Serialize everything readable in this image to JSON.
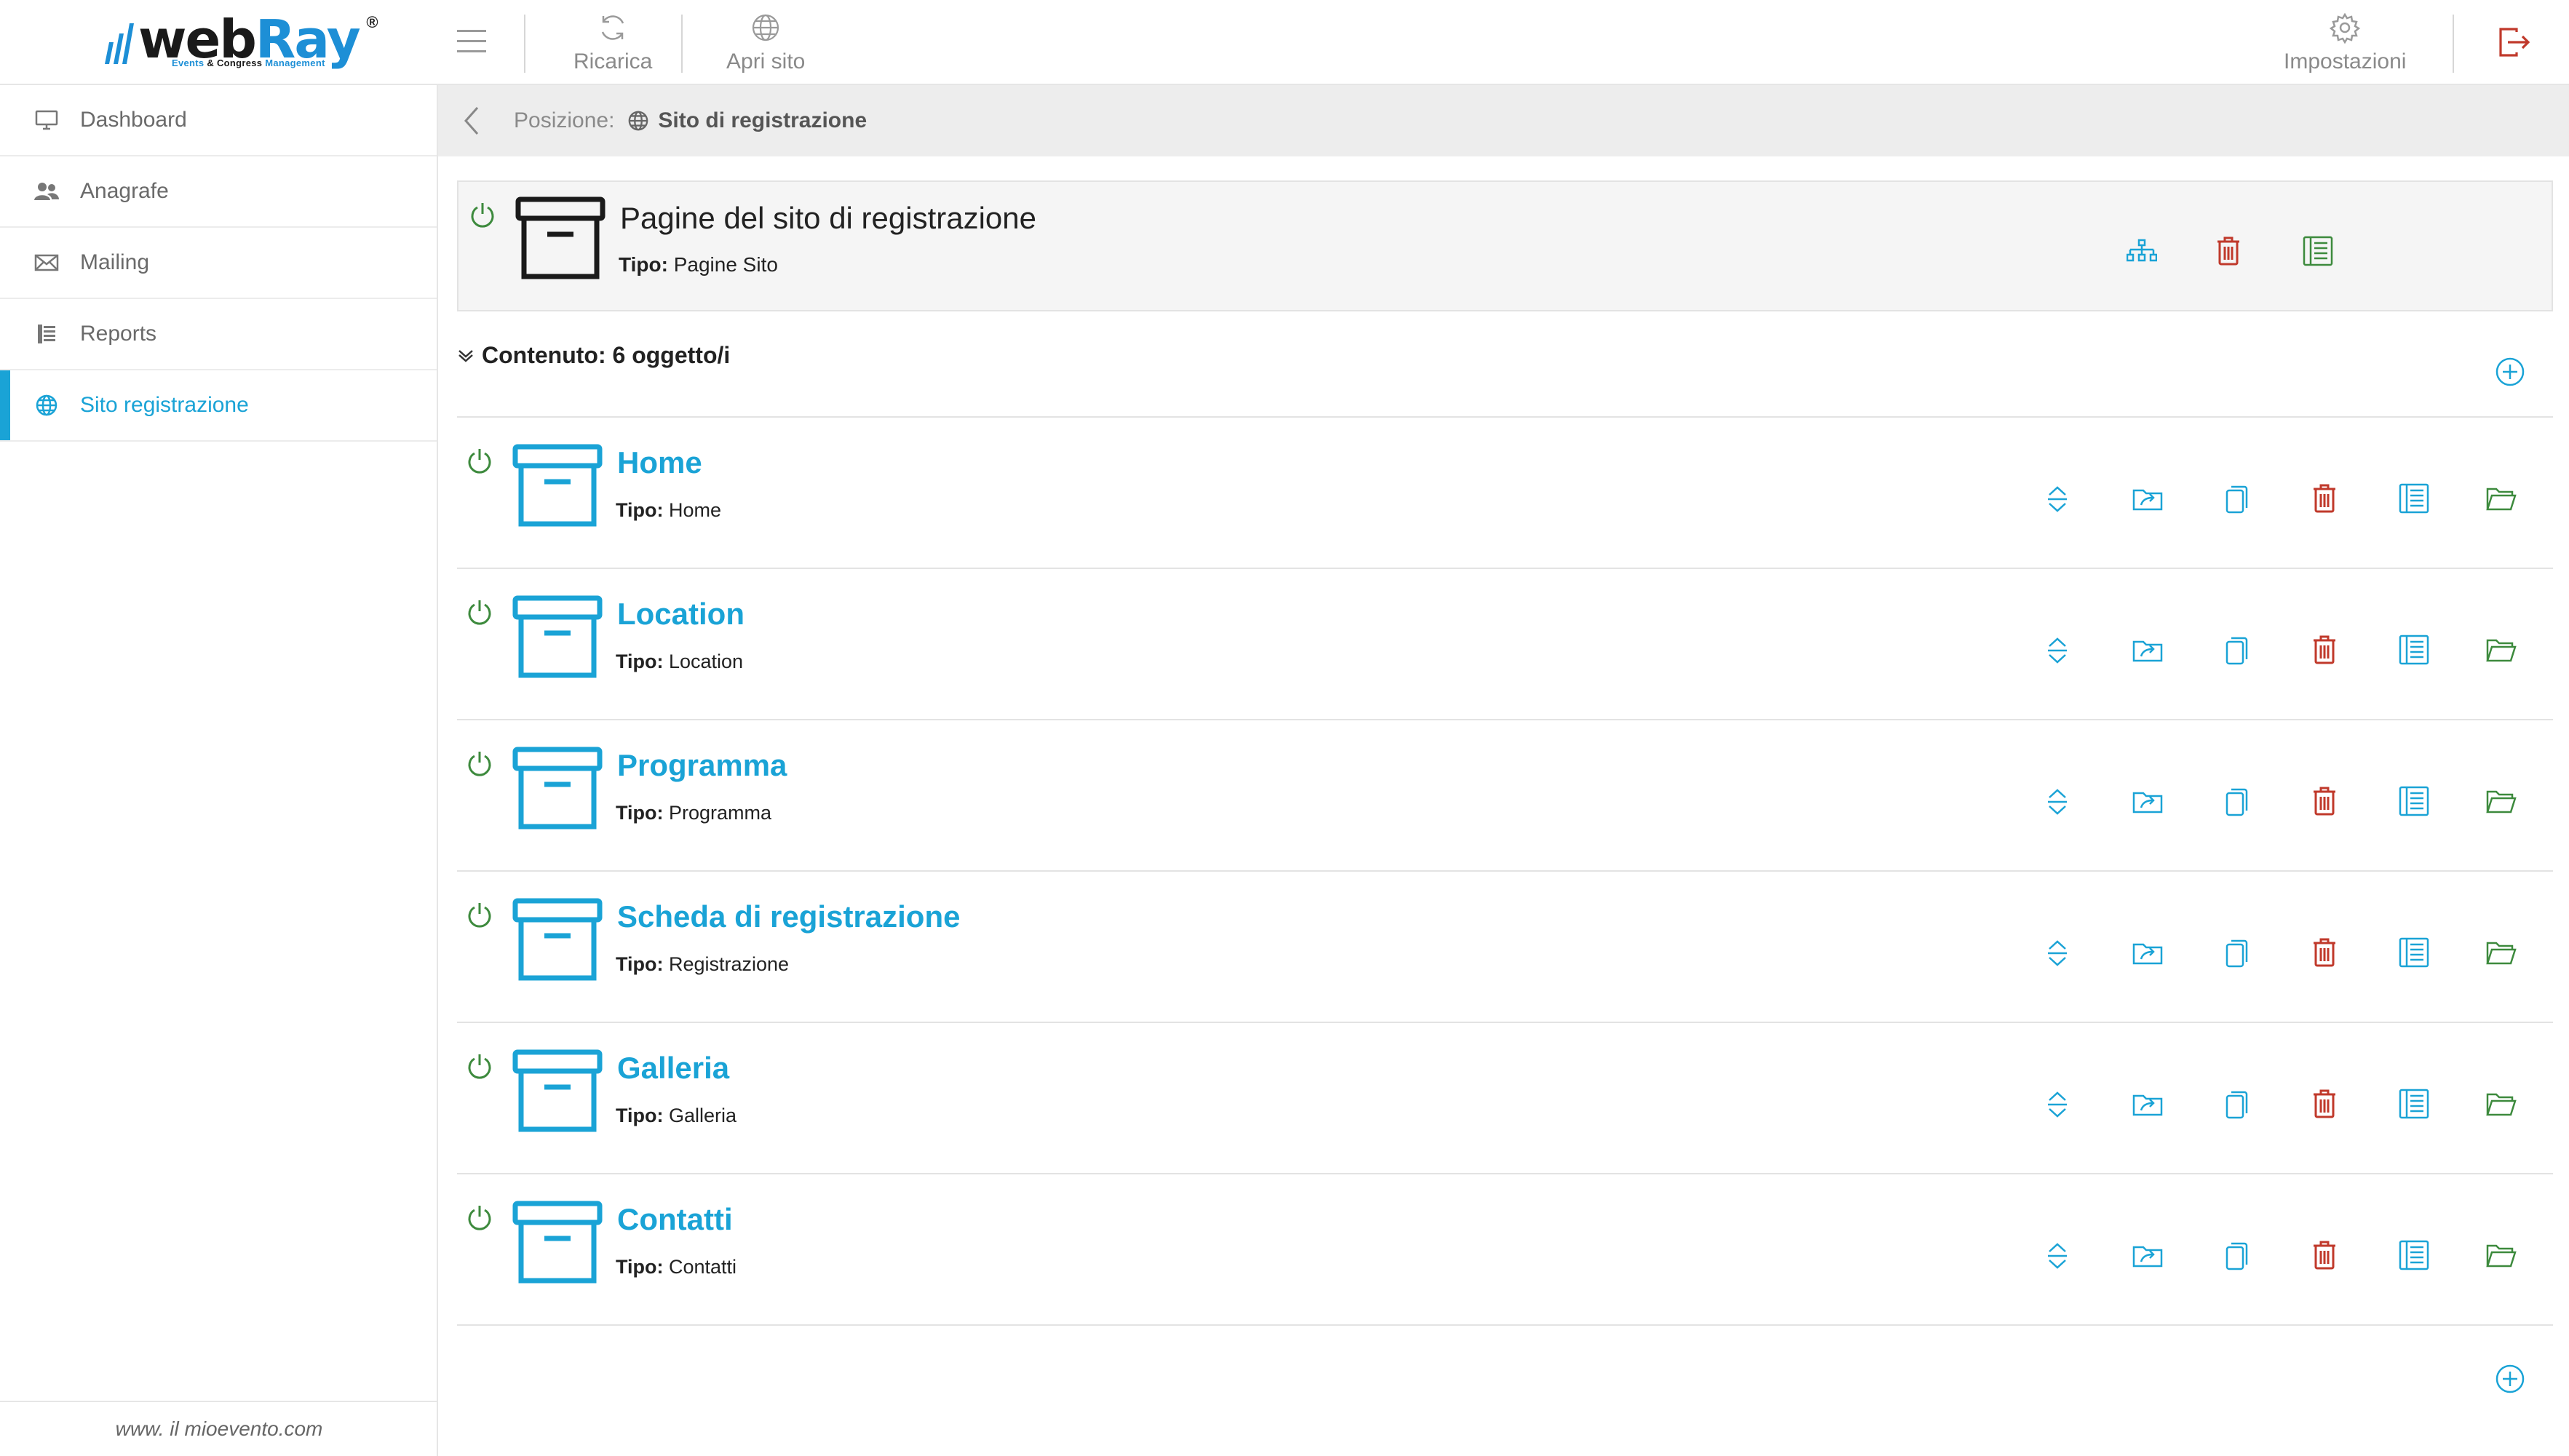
{
  "brand": {
    "part1": "web",
    "part2": "Ray",
    "reg": "®",
    "tagline_a": "Events",
    "tagline_b": " & Congress ",
    "tagline_c": "Management"
  },
  "toolbar": {
    "reload_label": "Ricarica",
    "open_site_label": "Apri sito",
    "settings_label": "Impostazioni"
  },
  "sidebar": {
    "items": [
      {
        "label": "Dashboard",
        "icon": "monitor-icon"
      },
      {
        "label": "Anagrafe",
        "icon": "users-icon"
      },
      {
        "label": "Mailing",
        "icon": "mail-icon"
      },
      {
        "label": "Reports",
        "icon": "report-icon"
      },
      {
        "label": "Sito registrazione",
        "icon": "globe-icon",
        "active": true
      }
    ],
    "footer": "www. il mioevento.com"
  },
  "breadcrumb": {
    "label": "Posizione:",
    "current": "Sito di registrazione"
  },
  "header": {
    "title": "Pagine del sito di registrazione",
    "type_label": "Tipo:",
    "type_value": " Pagine Sito"
  },
  "contents": {
    "label": "Contenuto: 6 oggetto/i"
  },
  "rows": [
    {
      "title": "Home",
      "type_label": "Tipo:",
      "type_value": " Home"
    },
    {
      "title": "Location",
      "type_label": "Tipo:",
      "type_value": " Location"
    },
    {
      "title": "Programma",
      "type_label": "Tipo:",
      "type_value": " Programma"
    },
    {
      "title": "Scheda di registrazione",
      "type_label": "Tipo:",
      "type_value": " Registrazione"
    },
    {
      "title": "Galleria",
      "type_label": "Tipo:",
      "type_value": " Galleria"
    },
    {
      "title": "Contatti",
      "type_label": "Tipo:",
      "type_value": " Contatti"
    }
  ],
  "colors": {
    "accent": "#1aa3d6",
    "danger": "#c0392b",
    "success": "#3d8a3d",
    "text": "#222222"
  }
}
